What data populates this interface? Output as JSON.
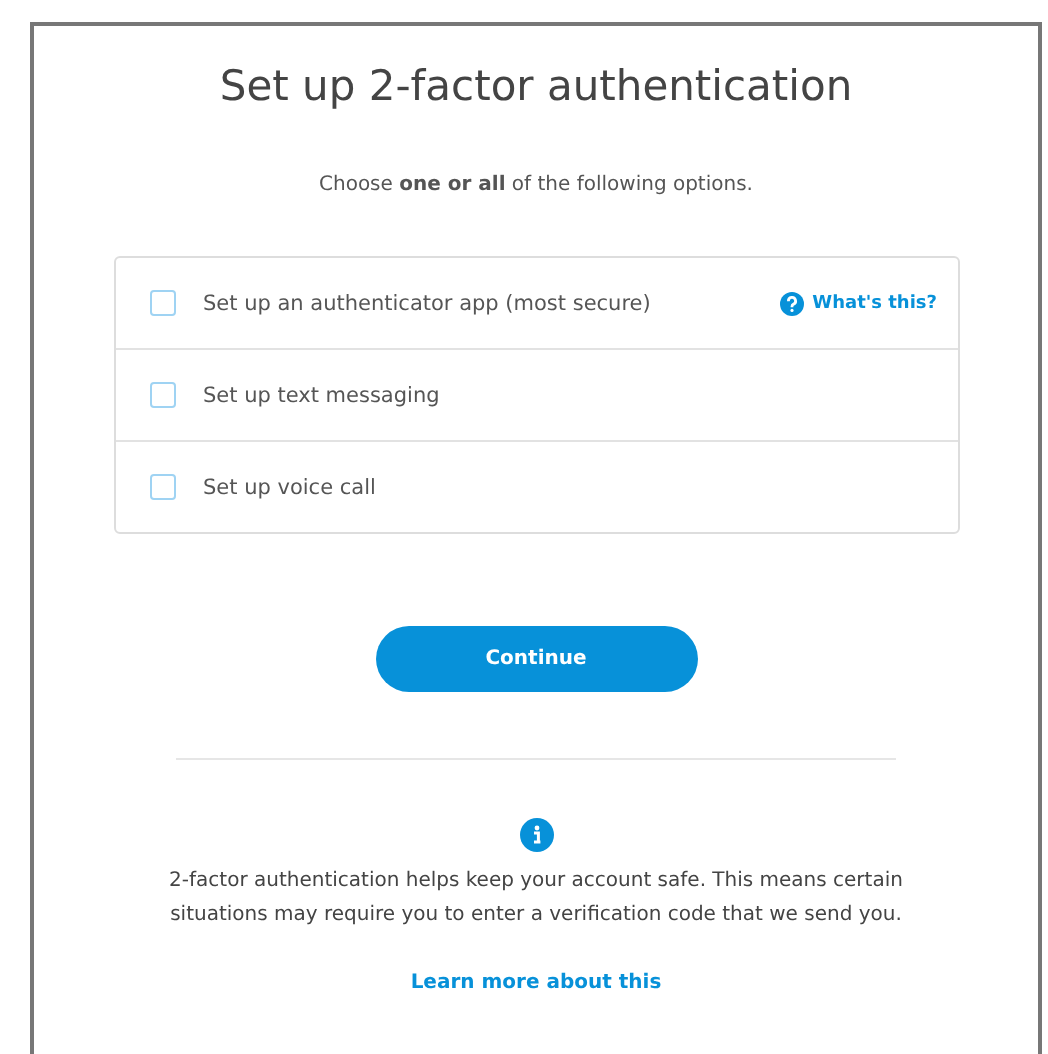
{
  "title": "Set up 2-factor authentication",
  "instruction": "Choose **one or all** of the following options.",
  "options": [
    {
      "label": "Set up an authenticator app (most secure)",
      "checked": false,
      "help_link": "What's this?"
    },
    {
      "label": "Set up text messaging",
      "checked": false
    },
    {
      "label": "Set up voice call",
      "checked": false
    }
  ],
  "continue_button": "Continue",
  "info": {
    "text": "2-factor authentication helps keep your account safe. This means certain situations may require you to enter a verification code that we send you.",
    "link": "Learn more about this"
  }
}
